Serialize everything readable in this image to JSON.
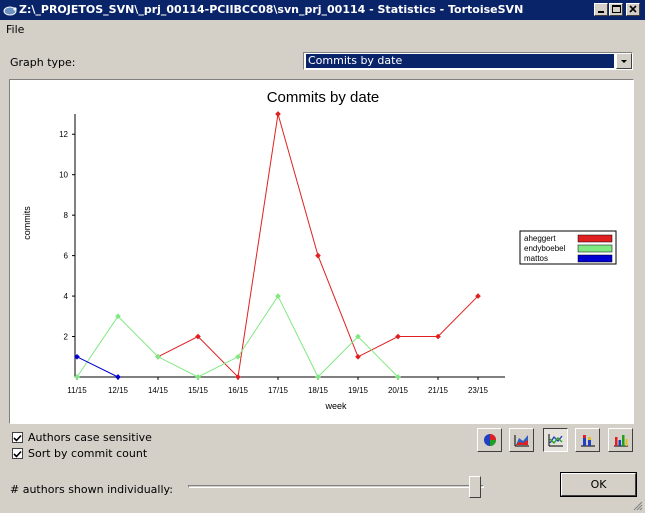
{
  "window": {
    "title": "Z:\\_PROJETOS_SVN\\_prj_00114-PCIIBCC08\\svn_prj_00114 - Statistics - TortoiseSVN"
  },
  "menu": {
    "file": "File"
  },
  "graph_type": {
    "label": "Graph type:",
    "selected": "Commits by date"
  },
  "options": {
    "authors_case_sensitive": {
      "label": "Authors case sensitive",
      "checked": true
    },
    "sort_by_commit_count": {
      "label": "Sort by commit count",
      "checked": true
    }
  },
  "authors_shown": {
    "label": "# authors shown individually:",
    "level": 1.0
  },
  "ok_label": "OK",
  "toolbar": [
    "pie-chart-icon",
    "area-chart-icon",
    "line-chart-icon",
    "stacked-bar-chart-icon",
    "bar-chart-icon"
  ],
  "chart_data": {
    "type": "line",
    "title": "Commits by date",
    "xlabel": "week",
    "ylabel": "commits",
    "categories": [
      "11/15",
      "12/15",
      "14/15",
      "15/15",
      "16/15",
      "17/15",
      "18/15",
      "19/15",
      "20/15",
      "21/15",
      "23/15"
    ],
    "yticks": [
      2,
      4,
      6,
      8,
      10,
      12
    ],
    "ylim": [
      0,
      13
    ],
    "legend": "right",
    "series": [
      {
        "name": "aheggert",
        "color": "#e02020",
        "values": [
          null,
          null,
          1,
          2,
          0,
          13,
          6,
          1,
          2,
          2,
          4
        ]
      },
      {
        "name": "endyboebel",
        "color": "#80e880",
        "values": [
          0,
          3,
          1,
          0,
          1,
          4,
          0,
          2,
          0,
          null,
          null
        ]
      },
      {
        "name": "mattos",
        "color": "#0000d0",
        "values": [
          1,
          0,
          null,
          null,
          null,
          null,
          null,
          null,
          null,
          null,
          null
        ]
      }
    ]
  }
}
